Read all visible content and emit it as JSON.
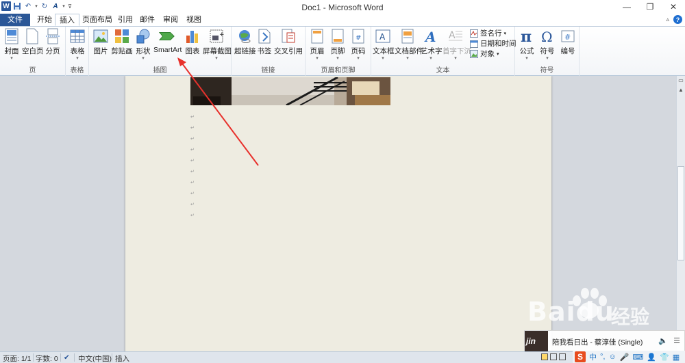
{
  "window": {
    "title": "Doc1 - Microsoft Word"
  },
  "tabs": [
    {
      "label": "文件",
      "id": "file"
    },
    {
      "label": "开始",
      "id": "home"
    },
    {
      "label": "插入",
      "id": "insert",
      "active": true
    },
    {
      "label": "页面布局",
      "id": "layout"
    },
    {
      "label": "引用",
      "id": "references"
    },
    {
      "label": "邮件",
      "id": "mailings"
    },
    {
      "label": "审阅",
      "id": "review"
    },
    {
      "label": "视图",
      "id": "view"
    }
  ],
  "ribbon": {
    "pages": {
      "label": "页",
      "cover": "封面",
      "blank": "空白页",
      "break": "分页"
    },
    "tables": {
      "label": "表格",
      "table": "表格"
    },
    "illustrations": {
      "label": "插图",
      "picture": "图片",
      "clipart": "剪贴画",
      "shapes": "形状",
      "smartart": "SmartArt",
      "chart": "图表",
      "screenshot": "屏幕截图"
    },
    "links": {
      "label": "链接",
      "hyperlink": "超链接",
      "bookmark": "书签",
      "crossref": "交叉引用"
    },
    "header_footer": {
      "label": "页眉和页脚",
      "header": "页眉",
      "footer": "页脚",
      "page_number": "页码"
    },
    "text": {
      "label": "文本",
      "textbox": "文本框",
      "quickparts": "文档部件",
      "wordart": "艺术字",
      "dropcap": "首字下沉",
      "signature": "签名行",
      "datetime": "日期和时间",
      "object": "对象"
    },
    "symbols": {
      "label": "符号",
      "equation": "公式",
      "symbol": "符号",
      "number": "编号"
    }
  },
  "document": {
    "paragraph_mark": "↵",
    "empty_paragraphs": 10
  },
  "statusbar": {
    "page": "页面: 1/1",
    "words": "字数: 0",
    "language": "中文(中国)",
    "mode": "插入"
  },
  "music": {
    "art_text": "jin",
    "song": "陪我看日出 - 蔡淳佳 (Single)"
  },
  "ime": {
    "lang": "中"
  },
  "watermark": {
    "brand": "Baidu",
    "sub": "经验"
  },
  "colors": {
    "file_tab": "#2b5797",
    "accent_arrow": "#e8312c",
    "page_bg": "#eeece1"
  }
}
